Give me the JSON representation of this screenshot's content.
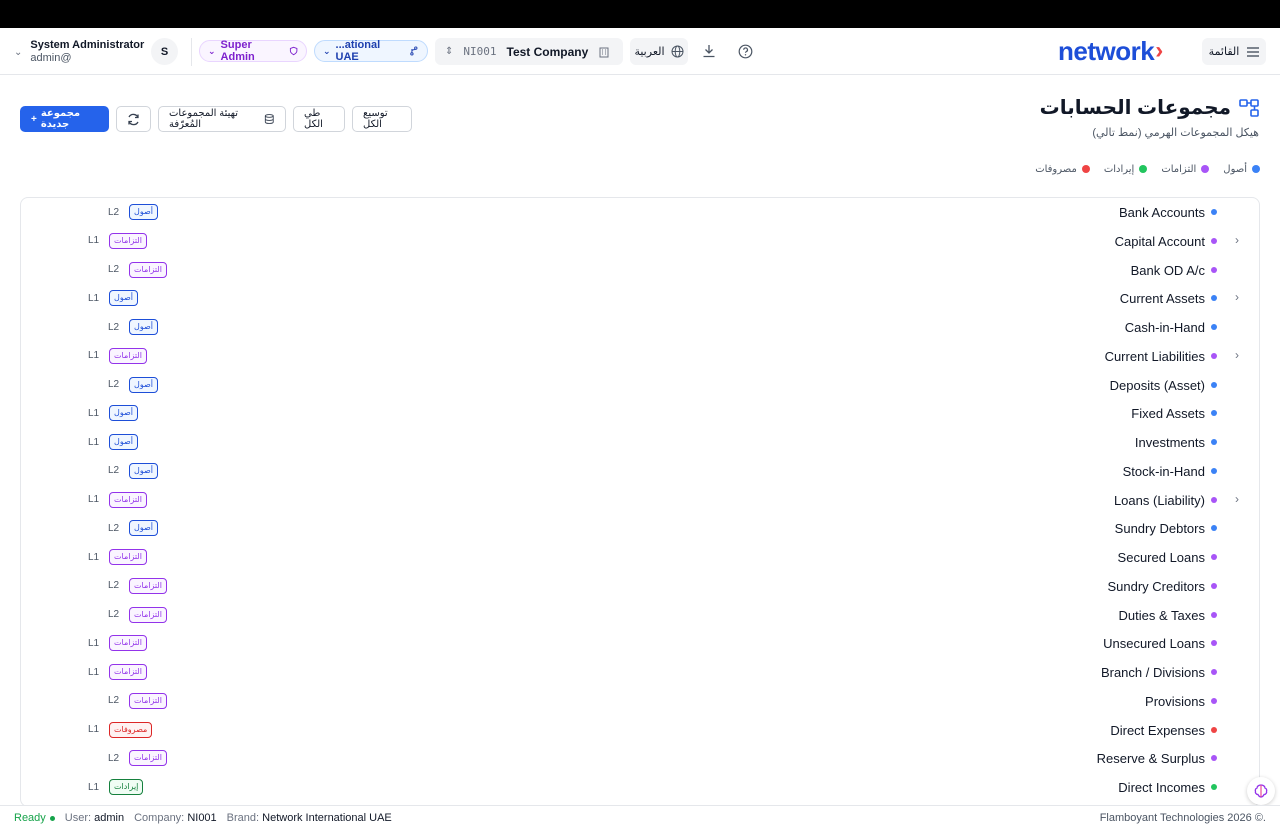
{
  "header": {
    "user_name": "System Administrator",
    "user_email": "admin@",
    "avatar_initial": "S",
    "role": "Super Admin",
    "brand": "...ational UAE",
    "company_code": "NI001",
    "company_name": "Test Company",
    "language": "العربية",
    "logo_text": "network",
    "menu_label": "القائمة"
  },
  "page": {
    "title": "مجموعات الحسابات",
    "subtitle": "هيكل المجموعات الهرمي (نمط تالي)"
  },
  "toolbar": {
    "new_group": "مجموعة جديدة",
    "seed_groups": "تهيئة المجموعات المُعرّفة",
    "collapse_all": "طي الكل",
    "expand_all": "توسيع الكل"
  },
  "legend": [
    {
      "label": "أصول",
      "color": "#3b82f6"
    },
    {
      "label": "التزامات",
      "color": "#a855f7"
    },
    {
      "label": "إيرادات",
      "color": "#22c55e"
    },
    {
      "label": "مصروفات",
      "color": "#ef4444"
    }
  ],
  "groups": [
    {
      "name": "Bank Accounts",
      "type": "asset",
      "badge": "أصول",
      "level": "L2",
      "expandable": false
    },
    {
      "name": "Capital Account",
      "type": "liab",
      "badge": "التزامات",
      "level": "L1",
      "expandable": true
    },
    {
      "name": "Bank OD A/c",
      "type": "liab",
      "badge": "التزامات",
      "level": "L2",
      "expandable": false
    },
    {
      "name": "Current Assets",
      "type": "asset",
      "badge": "أصول",
      "level": "L1",
      "expandable": true
    },
    {
      "name": "Cash-in-Hand",
      "type": "asset",
      "badge": "أصول",
      "level": "L2",
      "expandable": false
    },
    {
      "name": "Current Liabilities",
      "type": "liab",
      "badge": "التزامات",
      "level": "L1",
      "expandable": true
    },
    {
      "name": "Deposits (Asset)",
      "type": "asset",
      "badge": "أصول",
      "level": "L2",
      "expandable": false
    },
    {
      "name": "Fixed Assets",
      "type": "asset",
      "badge": "أصول",
      "level": "L1",
      "expandable": false
    },
    {
      "name": "Investments",
      "type": "asset",
      "badge": "أصول",
      "level": "L1",
      "expandable": false
    },
    {
      "name": "Stock-in-Hand",
      "type": "asset",
      "badge": "أصول",
      "level": "L2",
      "expandable": false
    },
    {
      "name": "Loans (Liability)",
      "type": "liab",
      "badge": "التزامات",
      "level": "L1",
      "expandable": true
    },
    {
      "name": "Sundry Debtors",
      "type": "asset",
      "badge": "أصول",
      "level": "L2",
      "expandable": false
    },
    {
      "name": "Secured Loans",
      "type": "liab",
      "badge": "التزامات",
      "level": "L1",
      "expandable": false
    },
    {
      "name": "Sundry Creditors",
      "type": "liab",
      "badge": "التزامات",
      "level": "L2",
      "expandable": false
    },
    {
      "name": "Duties & Taxes",
      "type": "liab",
      "badge": "التزامات",
      "level": "L2",
      "expandable": false
    },
    {
      "name": "Unsecured Loans",
      "type": "liab",
      "badge": "التزامات",
      "level": "L1",
      "expandable": false
    },
    {
      "name": "Branch / Divisions",
      "type": "liab",
      "badge": "التزامات",
      "level": "L1",
      "expandable": false
    },
    {
      "name": "Provisions",
      "type": "liab",
      "badge": "التزامات",
      "level": "L2",
      "expandable": false
    },
    {
      "name": "Direct Expenses",
      "type": "exp",
      "badge": "مصروفات",
      "level": "L1",
      "expandable": false
    },
    {
      "name": "Reserve & Surplus",
      "type": "liab",
      "badge": "التزامات",
      "level": "L2",
      "expandable": false
    },
    {
      "name": "Direct Incomes",
      "type": "inc",
      "badge": "إيرادات",
      "level": "L1",
      "expandable": false
    }
  ],
  "type_colors": {
    "asset": "#3b82f6",
    "liab": "#a855f7",
    "exp": "#ef4444",
    "inc": "#22c55e"
  },
  "statusbar": {
    "ready": "Ready",
    "user_label": "User:",
    "user_value": "admin",
    "company_label": "Company:",
    "company_value": "NI001",
    "brand_label": "Brand:",
    "brand_value": "Network International UAE",
    "copyright": "Flamboyant Technologies 2026 ©."
  }
}
